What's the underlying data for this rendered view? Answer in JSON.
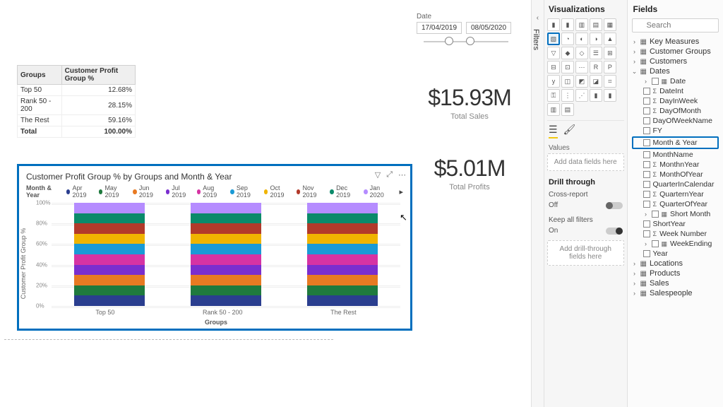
{
  "filter_tab": "Filters",
  "panes": {
    "viz_title": "Visualizations",
    "fields_title": "Fields",
    "values_label": "Values",
    "values_placeholder": "Add data fields here",
    "drill_title": "Drill through",
    "cross_report": "Cross-report",
    "cross_report_state": "Off",
    "keep_filters": "Keep all filters",
    "keep_filters_state": "On",
    "drill_placeholder": "Add drill-through fields here",
    "search_placeholder": "Search"
  },
  "field_tables": [
    {
      "name": "Key Measures",
      "expanded": false
    },
    {
      "name": "Customer Groups",
      "expanded": false
    },
    {
      "name": "Customers",
      "expanded": false
    },
    {
      "name": "Dates",
      "expanded": true,
      "children": [
        {
          "name": "Date",
          "kind": "hier",
          "expanded": false
        },
        {
          "name": "DateInt",
          "kind": "sigma"
        },
        {
          "name": "DayInWeek",
          "kind": "sigma"
        },
        {
          "name": "DayOfMonth",
          "kind": "sigma"
        },
        {
          "name": "DayOfWeekName",
          "kind": "text"
        },
        {
          "name": "FY",
          "kind": "text"
        },
        {
          "name": "Month & Year",
          "kind": "text",
          "highlight": true
        },
        {
          "name": "MonthName",
          "kind": "text"
        },
        {
          "name": "MonthnYear",
          "kind": "sigma"
        },
        {
          "name": "MonthOfYear",
          "kind": "sigma"
        },
        {
          "name": "QuarterInCalendar",
          "kind": "text"
        },
        {
          "name": "QuarternYear",
          "kind": "sigma"
        },
        {
          "name": "QuarterOfYear",
          "kind": "sigma"
        },
        {
          "name": "Short Month",
          "kind": "hier"
        },
        {
          "name": "ShortYear",
          "kind": "text"
        },
        {
          "name": "Week Number",
          "kind": "sigma"
        },
        {
          "name": "WeekEnding",
          "kind": "hier",
          "expanded": false
        },
        {
          "name": "Year",
          "kind": "text"
        }
      ]
    },
    {
      "name": "Locations",
      "expanded": false
    },
    {
      "name": "Products",
      "expanded": false
    },
    {
      "name": "Sales",
      "expanded": false
    },
    {
      "name": "Salespeople",
      "expanded": false
    }
  ],
  "table": {
    "headers": [
      "Groups",
      "Customer Profit Group %"
    ],
    "rows": [
      [
        "Top 50",
        "12.68%"
      ],
      [
        "Rank 50 - 200",
        "28.15%"
      ],
      [
        "The Rest",
        "59.16%"
      ]
    ],
    "total": [
      "Total",
      "100.00%"
    ]
  },
  "slicer": {
    "label": "Date",
    "from": "17/04/2019",
    "to": "08/05/2020"
  },
  "cards": [
    {
      "value": "$15.93M",
      "caption": "Total Sales"
    },
    {
      "value": "$5.01M",
      "caption": "Total Profits"
    }
  ],
  "chart": {
    "title": "Customer Profit Group % by Groups and Month & Year",
    "legend_title": "Month & Year",
    "xaxis": "Groups",
    "yaxis": "Customer Profit Group %",
    "yticks": [
      "0%",
      "20%",
      "40%",
      "60%",
      "80%",
      "100%"
    ]
  },
  "chart_data": {
    "type": "bar",
    "stacked_percent": true,
    "categories": [
      "Top 50",
      "Rank 50 - 200",
      "The Rest"
    ],
    "series": [
      {
        "name": "Apr 2019",
        "color": "#2a3e8f",
        "values": [
          10,
          10,
          10
        ]
      },
      {
        "name": "May 2019",
        "color": "#1f7a3e",
        "values": [
          10,
          10,
          10
        ]
      },
      {
        "name": "Jun 2019",
        "color": "#e87a22",
        "values": [
          10,
          10,
          10
        ]
      },
      {
        "name": "Jul 2019",
        "color": "#7a2ecf",
        "values": [
          10,
          10,
          10
        ]
      },
      {
        "name": "Aug 2019",
        "color": "#d633a3",
        "values": [
          10,
          10,
          10
        ]
      },
      {
        "name": "Sep 2019",
        "color": "#1a9ad6",
        "values": [
          10,
          10,
          10
        ]
      },
      {
        "name": "Oct 2019",
        "color": "#f0b400",
        "values": [
          10,
          10,
          10
        ]
      },
      {
        "name": "Nov 2019",
        "color": "#b23a2a",
        "values": [
          10,
          10,
          10
        ]
      },
      {
        "name": "Dec 2019",
        "color": "#0a8a6a",
        "values": [
          10,
          10,
          10
        ]
      },
      {
        "name": "Jan 2020",
        "color": "#b58cff",
        "values": [
          10,
          10,
          10
        ]
      }
    ],
    "ylim": [
      0,
      100
    ],
    "xlabel": "Groups",
    "ylabel": "Customer Profit Group %"
  }
}
